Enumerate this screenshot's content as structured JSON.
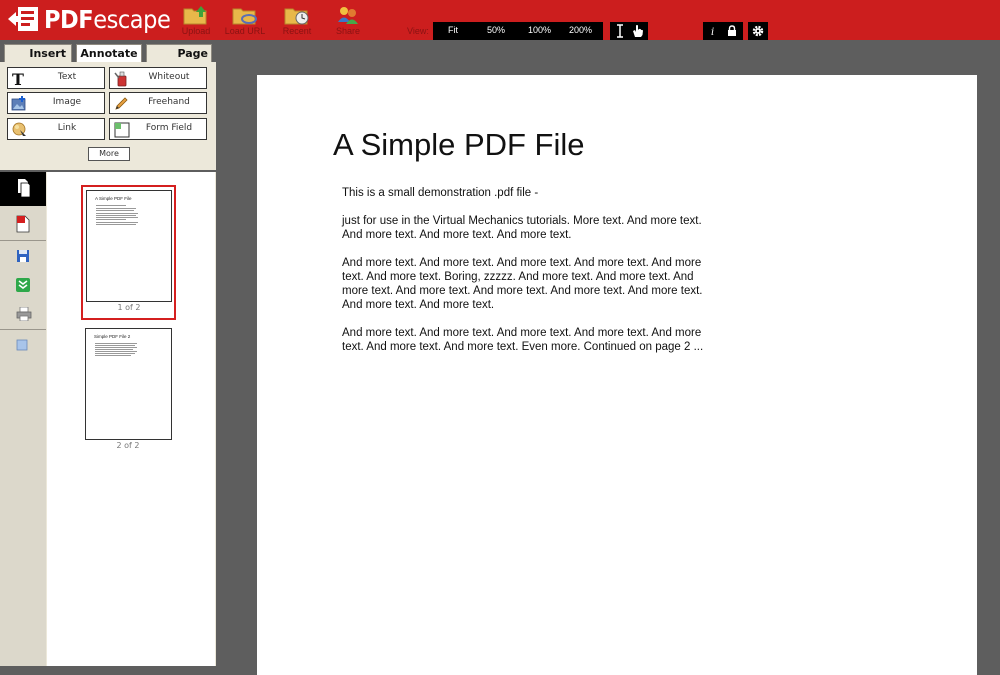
{
  "app": {
    "logo_prefix": "PDF",
    "logo_suffix": "escape"
  },
  "toolbar": {
    "upload_label": "Upload",
    "load_url_label": "Load URL",
    "recent_label": "Recent",
    "share_label": "Share",
    "view_label": "View:",
    "zoom_options": [
      "Fit",
      "50%",
      "100%",
      "200%"
    ]
  },
  "tabs": {
    "insert": "Insert",
    "annotate": "Annotate",
    "page": "Page"
  },
  "tools": {
    "text": "Text",
    "whiteout": "Whiteout",
    "image": "Image",
    "freehand": "Freehand",
    "link": "Link",
    "form_field": "Form Field",
    "more": "More"
  },
  "thumbnails": [
    {
      "title": "A Simple PDF File",
      "caption": "1 of 2",
      "selected": true
    },
    {
      "title": "Simple PDF File 2",
      "caption": "2 of 2",
      "selected": false
    }
  ],
  "document": {
    "title": "A Simple PDF File",
    "paragraphs": [
      "This is a small demonstration .pdf file -",
      "just for use in the Virtual Mechanics tutorials. More text. And more text. And more text. And more text. And more text.",
      "And more text. And more text. And more text. And more text. And more text. And more text. Boring, zzzzz. And more text. And more text. And more text. And more text. And more text. And more text. And more text. And more text. And more text.",
      "And more text. And more text. And more text. And more text. And more text. And more text. And more text. Even more. Continued on page 2 ..."
    ]
  },
  "colors": {
    "brand_red": "#cc1e1e",
    "panel_bg": "#ece8da",
    "workspace_bg": "#5e5e5e",
    "selection_red": "#d41f1f"
  }
}
